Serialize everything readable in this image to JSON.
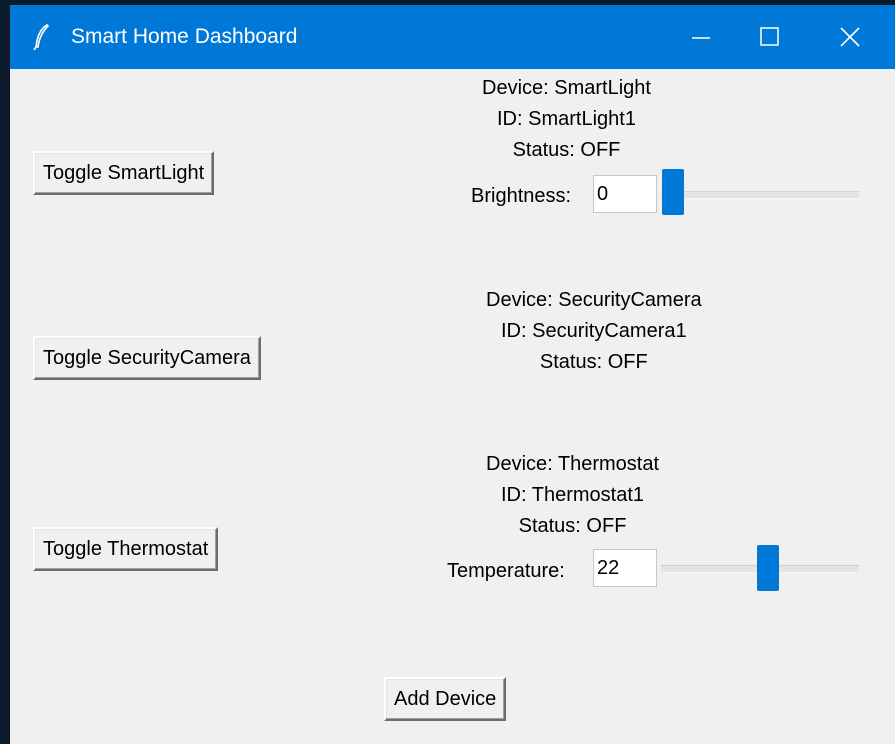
{
  "window": {
    "title": "Smart Home Dashboard",
    "icon": "feather-icon",
    "controls": [
      "minimize-icon",
      "maximize-icon",
      "close-icon"
    ]
  },
  "devices": [
    {
      "button_label": "Toggle SmartLight",
      "info": [
        "Device: SmartLight",
        "ID: SmartLight1",
        "Status: OFF"
      ],
      "slider": {
        "label": "Brightness:",
        "value": "0",
        "level": 0.0
      }
    },
    {
      "button_label": "Toggle SecurityCamera",
      "info": [
        "Device: SecurityCamera",
        "ID: SecurityCamera1",
        "Status: OFF"
      ]
    },
    {
      "button_label": "Toggle Thermostat",
      "info": [
        "Device: Thermostat",
        "ID: Thermostat1",
        "Status: OFF"
      ],
      "slider": {
        "label": "Temperature:",
        "value": "22",
        "level": 0.52
      }
    }
  ],
  "add_button_label": "Add Device",
  "colors": {
    "titlebar": "#0078d7",
    "slider_thumb": "#0078d7",
    "window_bg": "#f0f0f0"
  }
}
